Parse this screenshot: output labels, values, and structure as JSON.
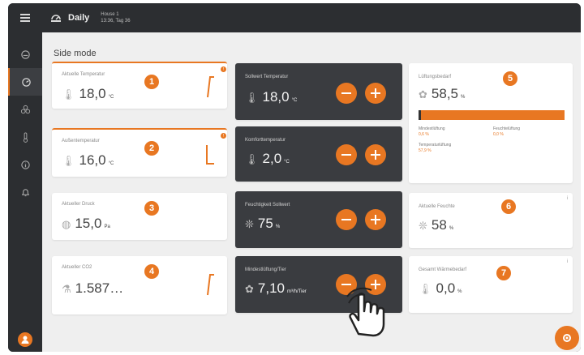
{
  "header": {
    "title": "Daily",
    "house_name": "House 1",
    "house_info": "13:36, Tag 36"
  },
  "mode_title": "Side mode",
  "cards": {
    "c1": {
      "label": "Aktuelle Temperatur",
      "value": "18,0",
      "unit": "°C",
      "badge": "1"
    },
    "c2": {
      "label": "Außentemperatur",
      "value": "16,0",
      "unit": "°C",
      "badge": "2"
    },
    "c3": {
      "label": "Aktueller Druck",
      "value": "15,0",
      "unit": "Pa",
      "badge": "3"
    },
    "c4": {
      "label": "Aktueller CO2",
      "value": "1.587…",
      "unit": "",
      "badge": "4"
    },
    "d1": {
      "label": "Sollwert Temperatur",
      "value": "18,0",
      "unit": "°C"
    },
    "d2": {
      "label": "Komforttemperatur",
      "value": "2,0",
      "unit": "°C"
    },
    "d3": {
      "label": "Feuchtigkeit Sollwert",
      "value": "75",
      "unit": "%"
    },
    "d4": {
      "label": "Mindestlüftung/Tier",
      "value": "7,10",
      "unit": "m³/h/Tier"
    },
    "r1": {
      "label": "Lüftungsbedarf",
      "value": "58,5",
      "unit": "%",
      "badge": "5",
      "mini1_label": "Mindestlüftung",
      "mini1_value": "0,6 %",
      "mini2_label": "Feuchtelüftung",
      "mini2_value": "0,0 %",
      "mini3_label": "Temperaturlüftung",
      "mini3_value": "57,9 %"
    },
    "r2": {
      "label": "Aktuelle Feuchte",
      "value": "58",
      "unit": "%",
      "badge": "6"
    },
    "r3": {
      "label": "Gesamt Wärmebedarf",
      "value": "0,0",
      "unit": "%",
      "badge": "7"
    }
  },
  "colors": {
    "accent": "#e87722",
    "dark_card": "#3a3c40",
    "sidebar": "#2c2e31"
  },
  "icons": [
    "menu-icon",
    "dashboard-icon",
    "fan-icon",
    "thermometer-icon",
    "info-icon",
    "bell-icon",
    "user-icon",
    "settings-icon",
    "hand-pointer-icon"
  ]
}
